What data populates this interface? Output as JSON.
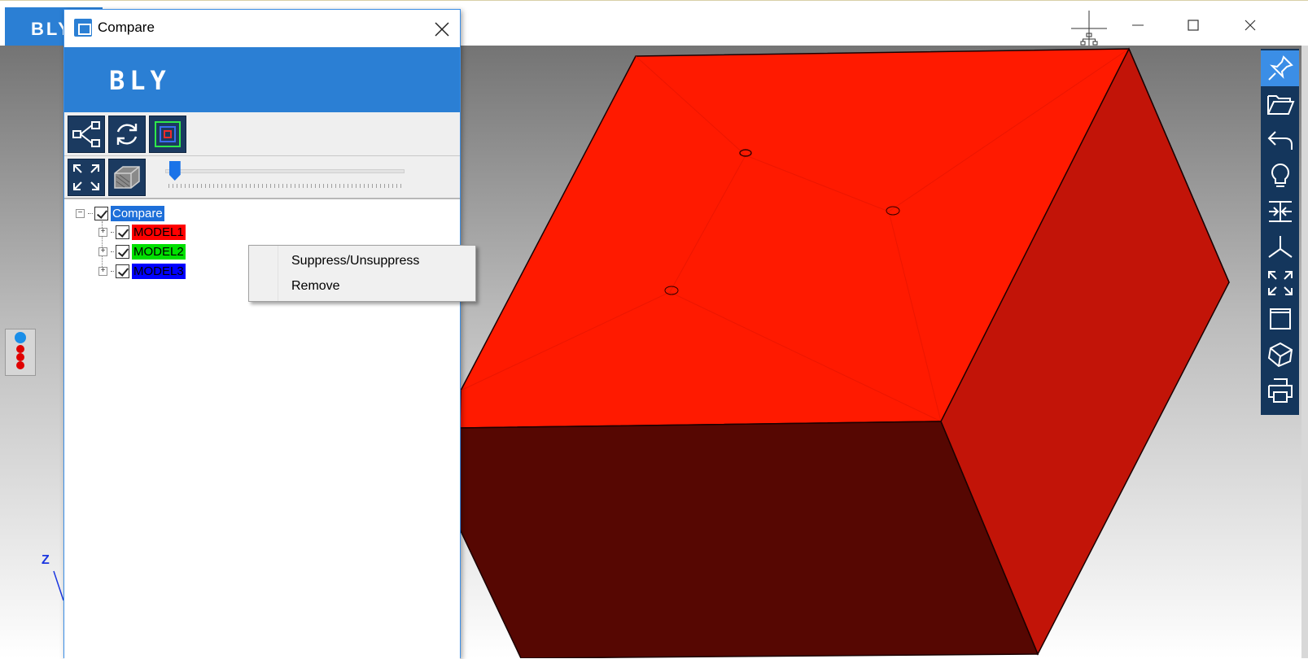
{
  "main_window": {
    "app_logo": "BLY"
  },
  "dialog": {
    "title": "Compare",
    "banner_logo": "BLY",
    "slider": {
      "value_fraction": 0.04
    }
  },
  "tree": {
    "root": {
      "label": "Compare",
      "checked": true,
      "selected": true,
      "color": "#1e6fd9"
    },
    "children": [
      {
        "label": "MODEL1",
        "checked": true,
        "color": "#ff0000"
      },
      {
        "label": "MODEL2",
        "checked": true,
        "color": "#00e000"
      },
      {
        "label": "MODEL3",
        "checked": true,
        "color": "#0000ff"
      }
    ]
  },
  "context_menu": {
    "items": [
      "Suppress/Unsuppress",
      "Remove"
    ]
  },
  "viewport": {
    "axis_label": "Z",
    "model_color": "#ff1a00"
  },
  "right_toolbar": {
    "icons": [
      "pin-icon",
      "folder-open-icon",
      "undo-icon",
      "lightbulb-icon",
      "import-icon",
      "axes-icon",
      "fit-view-icon",
      "view-cube-icon",
      "shading-icon",
      "print-icon"
    ]
  }
}
